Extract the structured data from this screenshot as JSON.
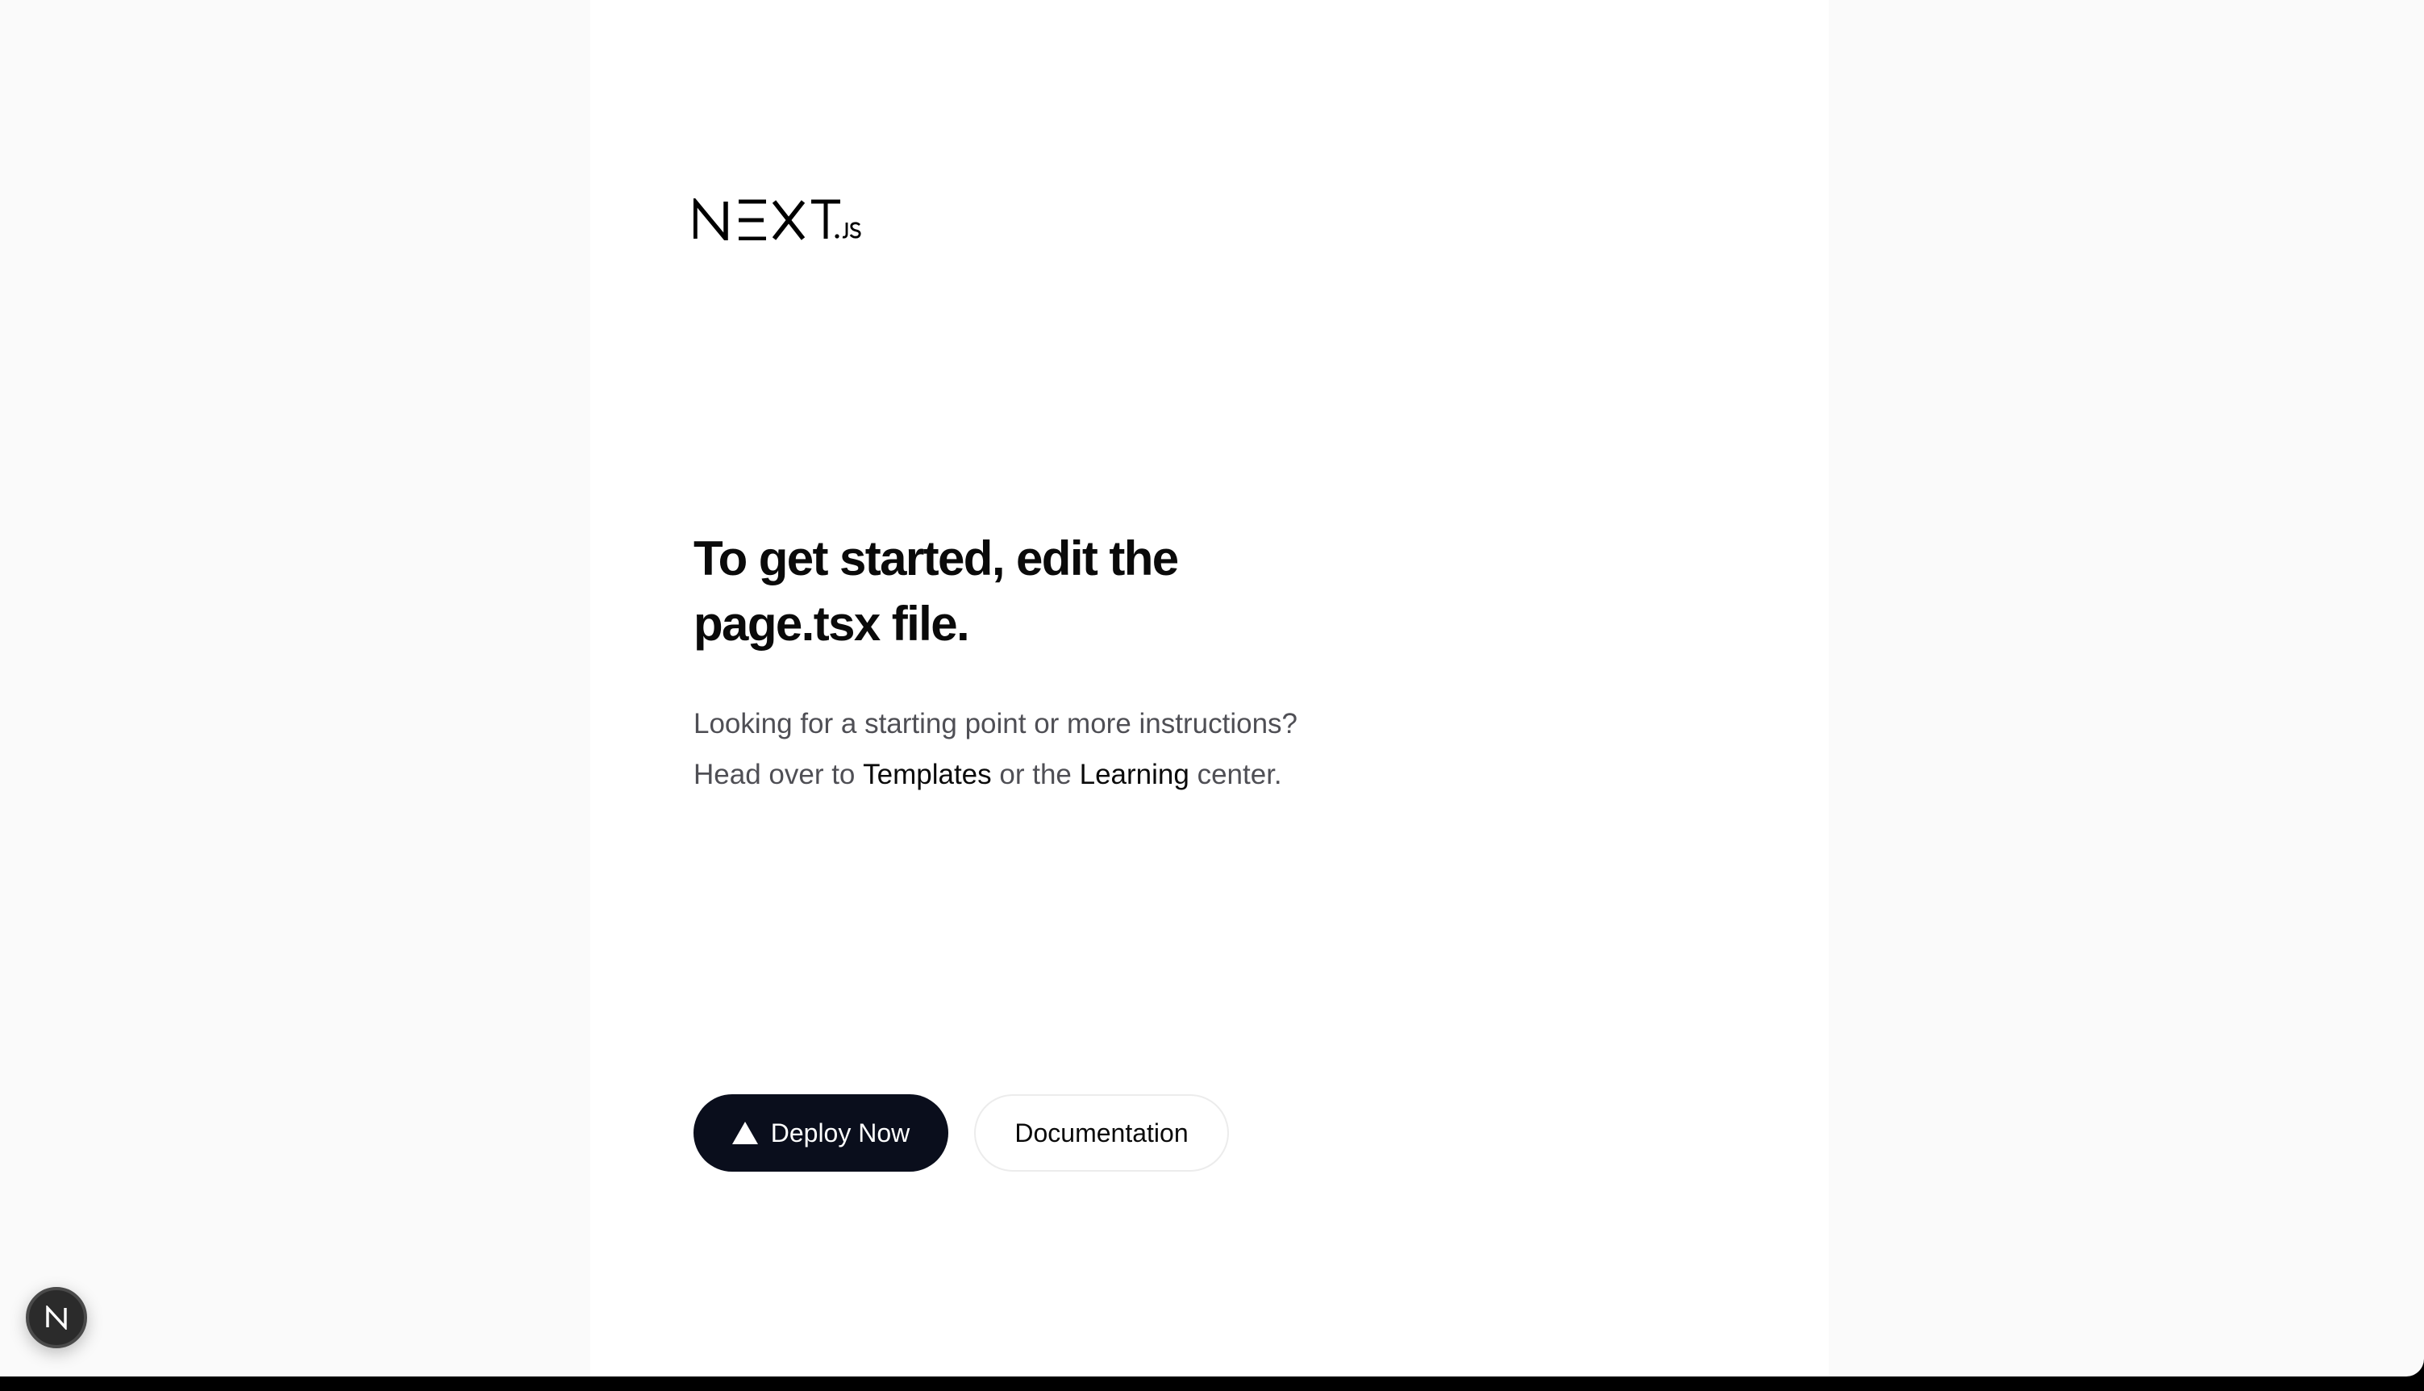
{
  "brand": {
    "logo_icon": "nextjs-wordmark",
    "logo_text": "NEXT.JS"
  },
  "main": {
    "heading_line1": "To get started, edit the",
    "heading_line2": "page.tsx file.",
    "description_line1": "Looking for a starting point or more instructions?",
    "description_prefix": "Head over to ",
    "templates_link": "Templates",
    "description_middle": " or the ",
    "learning_link": "Learning",
    "description_suffix": " center."
  },
  "actions": {
    "deploy_label": "Deploy Now",
    "deploy_icon": "vercel-triangle-icon",
    "docs_label": "Documentation"
  },
  "dev_indicator": {
    "icon": "nextjs-n-icon"
  },
  "colors": {
    "page_background": "#fafafa",
    "card_background": "#ffffff",
    "text_primary": "#0a0a0a",
    "text_secondary": "#4f4f55",
    "deploy_button_background": "#0a0e1c",
    "docs_button_border": "#ececec",
    "dev_indicator_background": "#2b2b2b"
  }
}
